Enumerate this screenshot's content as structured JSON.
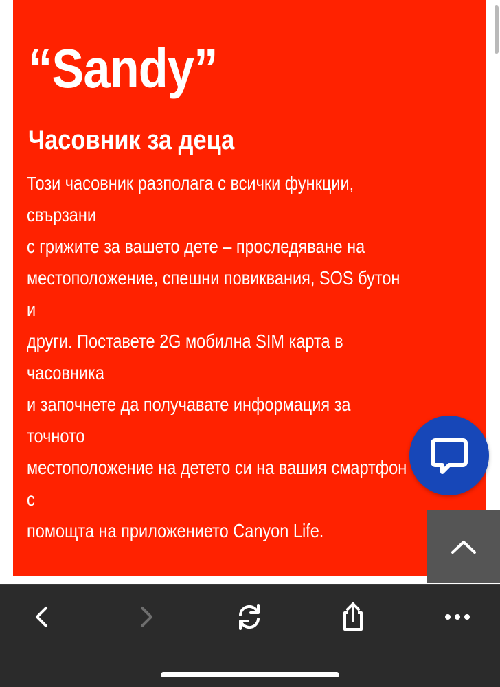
{
  "product": {
    "title": "“Sandy”",
    "subtitle": "Часовник за деца",
    "description_lines": [
      "Този часовник разполага с всички функции,",
      "свързани",
      "с грижите за вашето дете – проследяване на",
      "местоположение, спешни повиквания, SOS бутон",
      "и",
      "други. Поставете 2G мобилна SIM карта в",
      "часовника",
      "и започнете да получавате информация за",
      "точното",
      "местоположение на детето си на вашия смартфон",
      "с",
      "помощта на приложението Canyon Life."
    ]
  },
  "colors": {
    "panel_background": "#ff2200",
    "chat_button": "#1747b8",
    "back_to_top": "#555555",
    "toolbar": "#2b2b2b",
    "toolbar_icon": "#ffffff",
    "toolbar_icon_disabled": "#6e6e6e"
  },
  "floating": {
    "chat_icon": "chat-bubble-icon",
    "back_to_top_icon": "chevron-up-icon"
  },
  "toolbar": {
    "buttons": [
      {
        "name": "back-button",
        "icon": "chevron-left-icon",
        "enabled": true
      },
      {
        "name": "forward-button",
        "icon": "chevron-right-icon",
        "enabled": false
      },
      {
        "name": "reload-button",
        "icon": "reload-icon",
        "enabled": true
      },
      {
        "name": "share-button",
        "icon": "share-icon",
        "enabled": true
      },
      {
        "name": "more-button",
        "icon": "more-dots-icon",
        "enabled": true
      }
    ]
  }
}
